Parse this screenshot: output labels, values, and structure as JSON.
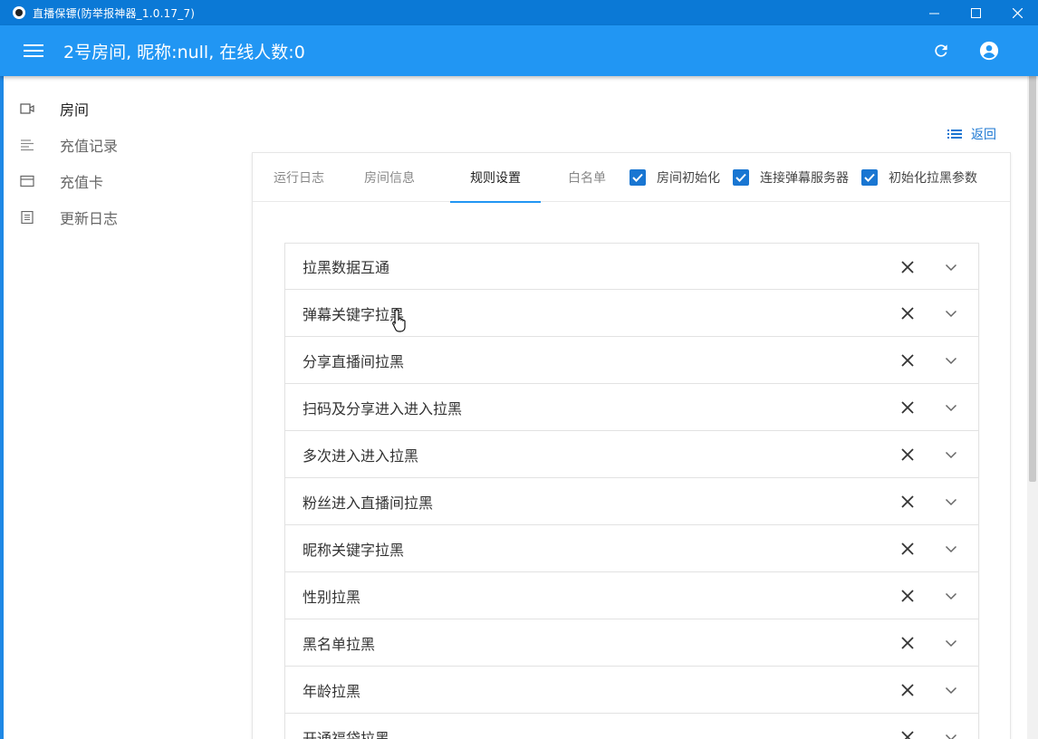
{
  "window": {
    "title": "直播保镖(防举报神器_1.0.17_7)",
    "controls": {
      "minimize": "—",
      "maximize": "☐",
      "close": "✕"
    }
  },
  "header": {
    "title": "2号房间, 昵称:null, 在线人数:0",
    "menu_icon": "menu-icon",
    "refresh_icon": "refresh-icon",
    "account_icon": "account-circle-icon",
    "color": "#2196f3"
  },
  "sidebar": {
    "items": [
      {
        "label": "房间",
        "icon": "video-camera-icon",
        "active": true
      },
      {
        "label": "充值记录",
        "icon": "list-lines-icon",
        "active": false
      },
      {
        "label": "充值卡",
        "icon": "card-icon",
        "active": false
      },
      {
        "label": "更新日志",
        "icon": "document-icon",
        "active": false
      }
    ]
  },
  "back_link": {
    "label": "返回",
    "icon": "list-icon"
  },
  "tabs": [
    {
      "label": "运行日志",
      "active": false
    },
    {
      "label": "房间信息",
      "active": false
    },
    {
      "label": "规则设置",
      "active": true
    },
    {
      "label": "白名单",
      "active": false
    }
  ],
  "checks": [
    {
      "label": "房间初始化",
      "checked": true
    },
    {
      "label": "连接弹幕服务器",
      "checked": true
    },
    {
      "label": "初始化拉黑参数",
      "checked": true
    }
  ],
  "rules": [
    "拉黑数据互通",
    "弹幕关键字拉黑",
    "分享直播间拉黑",
    "扫码及分享进入进入拉黑",
    "多次进入进入拉黑",
    "粉丝进入直播间拉黑",
    "昵称关键字拉黑",
    "性别拉黑",
    "黑名单拉黑",
    "年龄拉黑",
    "开通福袋拉黑"
  ],
  "colors": {
    "accent": "#2196f3",
    "titlebar": "#0b79d6",
    "checkbox": "#1976d2"
  }
}
